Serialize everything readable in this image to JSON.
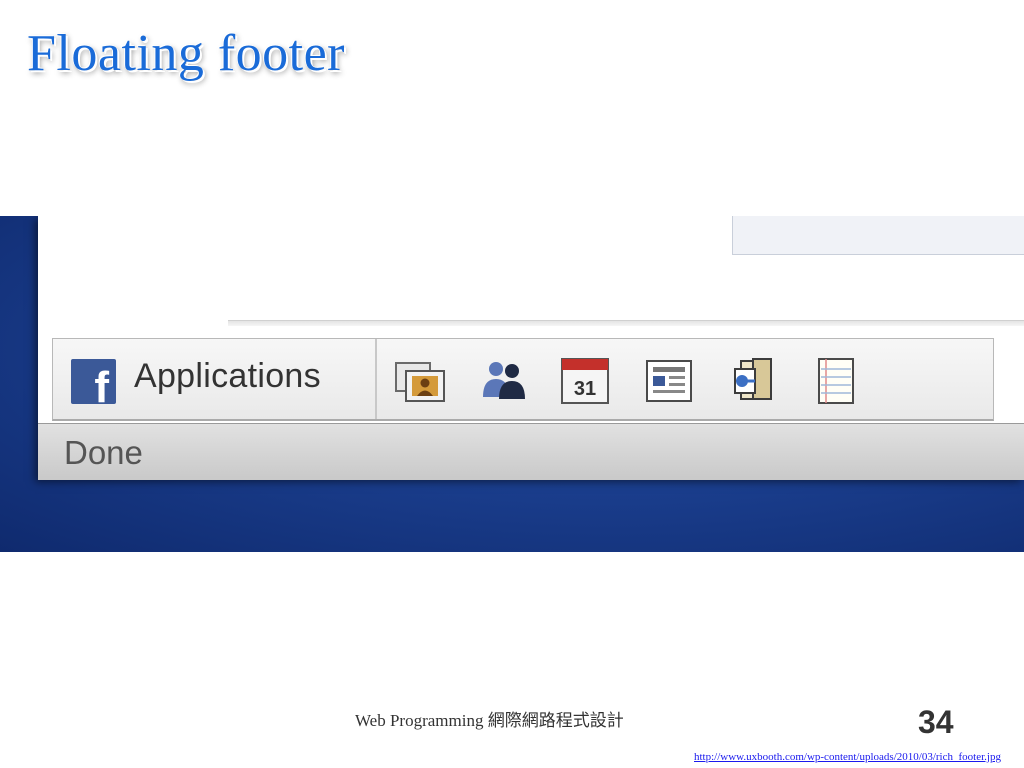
{
  "slide": {
    "title": "Floating footer",
    "footer_text": "Web Programming 網際網路程式設計",
    "page_number": "34",
    "source_url": "http://www.uxbooth.com/wp-content/uploads/2010/03/rich_footer.jpg"
  },
  "facebook_bar": {
    "logo_letter": "f",
    "applications_label": "Applications",
    "icons": [
      "photos-icon",
      "friends-icon",
      "calendar-icon",
      "notes-icon",
      "links-icon",
      "notepad-icon"
    ],
    "calendar_day": "31"
  },
  "status_bar": {
    "status_text": "Done"
  },
  "colors": {
    "title": "#1a6bd8",
    "facebook_blue": "#3b5998",
    "desktop_blue": "#1b3f8f"
  }
}
